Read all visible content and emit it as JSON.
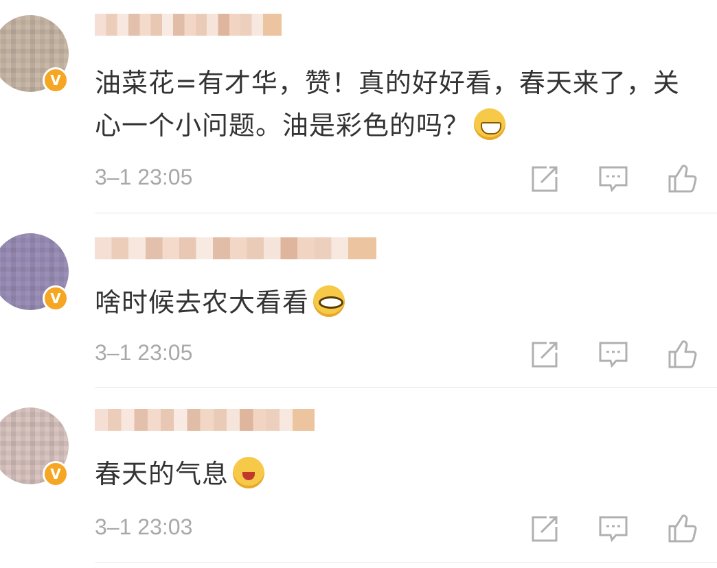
{
  "comments": [
    {
      "text": "油菜花=有才华，赞！真的好好看，春天来了，关心一个小问题。油是彩色的吗？",
      "emoji": "grinning-emoji",
      "time": "3–1 23:05",
      "badge": "V"
    },
    {
      "text": "啥时候去农大看看",
      "emoji": "peeking-emoji",
      "time": "3–1 23:05",
      "badge": "V"
    },
    {
      "text": "春天的气息",
      "emoji": "crying-laughing-emoji",
      "time": "3–1 23:03",
      "badge": "V"
    }
  ],
  "icons": {
    "repost": "repost-icon",
    "comment": "comment-icon",
    "like": "like-icon"
  },
  "colors": {
    "badge": "#f5a623",
    "time": "#a8a8a8",
    "text": "#333333",
    "icon": "#b0b0b0"
  }
}
